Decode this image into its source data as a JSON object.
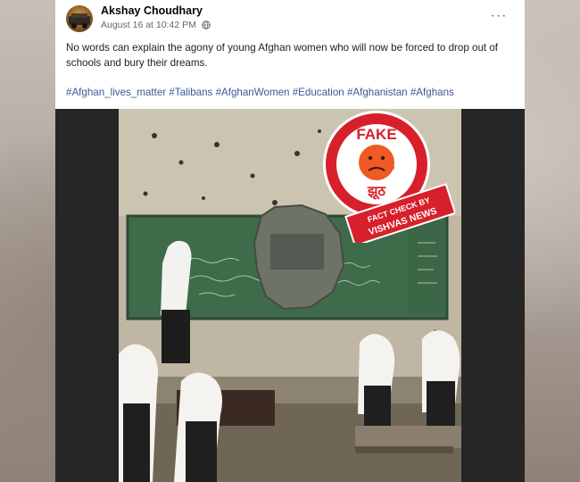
{
  "post": {
    "author": "Akshay Choudhary",
    "date": "August 16 at 10:42 PM",
    "more_icon": "more-options-icon",
    "text": "No words can explain the agony of young Afghan women who will now be forced to drop out of schools and bury their dreams.",
    "hashtags": "#Afghan_lives_matter #Talibans #AfghanWomen #Education #Afghanistan #Afghans"
  },
  "photo": {
    "description": "classroom with damaged chalkboard and girls in white headscarves",
    "overlay": {
      "stamp_text": "FAKE",
      "stamp_hindi": "झूठ",
      "ribbon_line1": "FACT CHECK BY",
      "ribbon_line2": "VISHVAS NEWS"
    }
  },
  "colors": {
    "link": "#385898",
    "stamp_red": "#d7202b",
    "emoji_orange": "#f05a24"
  }
}
